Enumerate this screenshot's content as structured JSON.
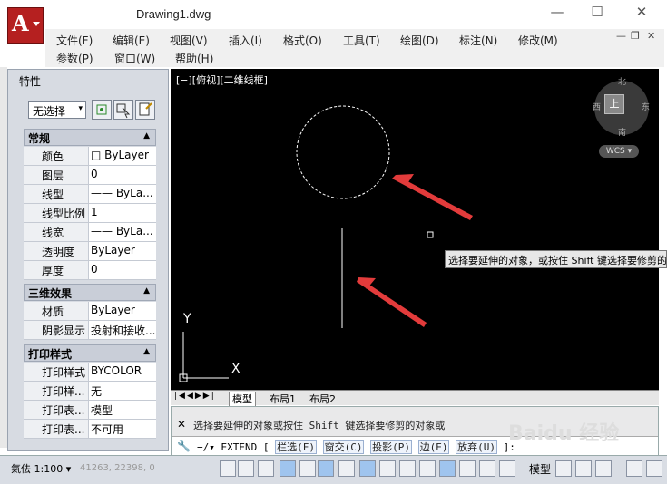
{
  "app": {
    "title": "Drawing1.dwg",
    "logo_letter": "A"
  },
  "window": {
    "minimize": "—",
    "maximize": "☐",
    "close": "✕"
  },
  "menus": [
    "文件(F)",
    "编辑(E)",
    "视图(V)",
    "插入(I)",
    "格式(O)",
    "工具(T)",
    "绘图(D)",
    "标注(N)",
    "修改(M)",
    "参数(P)",
    "窗口(W)",
    "帮助(H)"
  ],
  "mdi": {
    "minimize": "—",
    "restore": "❐",
    "close": "✕"
  },
  "properties": {
    "title": "特性",
    "selection": "无选择",
    "sections": {
      "general": "常规",
      "three_d": "三维效果",
      "plot": "打印样式"
    },
    "general_rows": [
      {
        "key": "颜色",
        "value": "□ ByLayer"
      },
      {
        "key": "图层",
        "value": "0"
      },
      {
        "key": "线型",
        "value": "—— ByLa..."
      },
      {
        "key": "线型比例",
        "value": "1"
      },
      {
        "key": "线宽",
        "value": "—— ByLa..."
      },
      {
        "key": "透明度",
        "value": "ByLayer"
      },
      {
        "key": "厚度",
        "value": "0"
      }
    ],
    "three_d_rows": [
      {
        "key": "材质",
        "value": "ByLayer"
      },
      {
        "key": "阴影显示",
        "value": "投射和接收..."
      }
    ],
    "plot_rows": [
      {
        "key": "打印样式",
        "value": "BYCOLOR"
      },
      {
        "key": "打印样...",
        "value": "无"
      },
      {
        "key": "打印表...",
        "value": "模型"
      },
      {
        "key": "打印表...",
        "value": "不可用"
      }
    ]
  },
  "viewport": {
    "label": "[−][俯视][二维线框]",
    "cube_top": "上",
    "compass": {
      "n": "北",
      "s": "南",
      "e": "东",
      "w": "西"
    },
    "wcs": "WCS ▾",
    "ucs_x": "X",
    "ucs_y": "Y"
  },
  "tooltip": "选择要延伸的对象，或按住 Shift 键选择要修剪的对象或",
  "layout_tabs": [
    "模型",
    "布局1",
    "布局2"
  ],
  "command": {
    "history": "选择要延伸的对象或按住 Shift 键选择要修剪的对象或",
    "prompt_prefix": "−/▾ EXTEND [",
    "options": [
      "栏选(F)",
      "窗交(C)",
      "投影(P)",
      "边(E)",
      "放弃(U)"
    ],
    "prompt_suffix": "]:"
  },
  "status": {
    "scale": "氣佉 1:100 ▾",
    "coords": "41263, 22398, 0",
    "model_label": "模型"
  },
  "watermark": "Baidu 经验"
}
